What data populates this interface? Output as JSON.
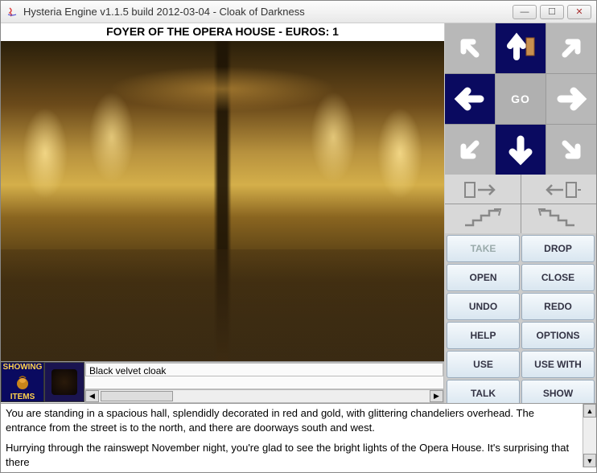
{
  "window": {
    "title": "Hysteria Engine v1.1.5 build 2012-03-04 - Cloak of Darkness"
  },
  "location": {
    "header": "FOYER OF THE OPERA HOUSE - EUROS: 1"
  },
  "inventory": {
    "showing_top": "SHOWING",
    "showing_bottom": "ITEMS",
    "selected_label": "Black velvet cloak"
  },
  "compass": {
    "go_label": "GO"
  },
  "actions": {
    "take": "TAKE",
    "drop": "DROP",
    "open": "OPEN",
    "close": "CLOSE",
    "undo": "UNDO",
    "redo": "REDO",
    "help": "HELP",
    "options": "OPTIONS",
    "use": "USE",
    "use_with": "USE WITH",
    "talk": "TALK",
    "show": "SHOW"
  },
  "narrative": {
    "p1": "You are standing in a spacious hall, splendidly decorated in red and gold, with glittering chandeliers overhead. The entrance from the street is to the north, and there are doorways south and west.",
    "p2": "Hurrying through the rainswept November night, you're glad to see the bright lights of the Opera House. It's surprising that there"
  }
}
